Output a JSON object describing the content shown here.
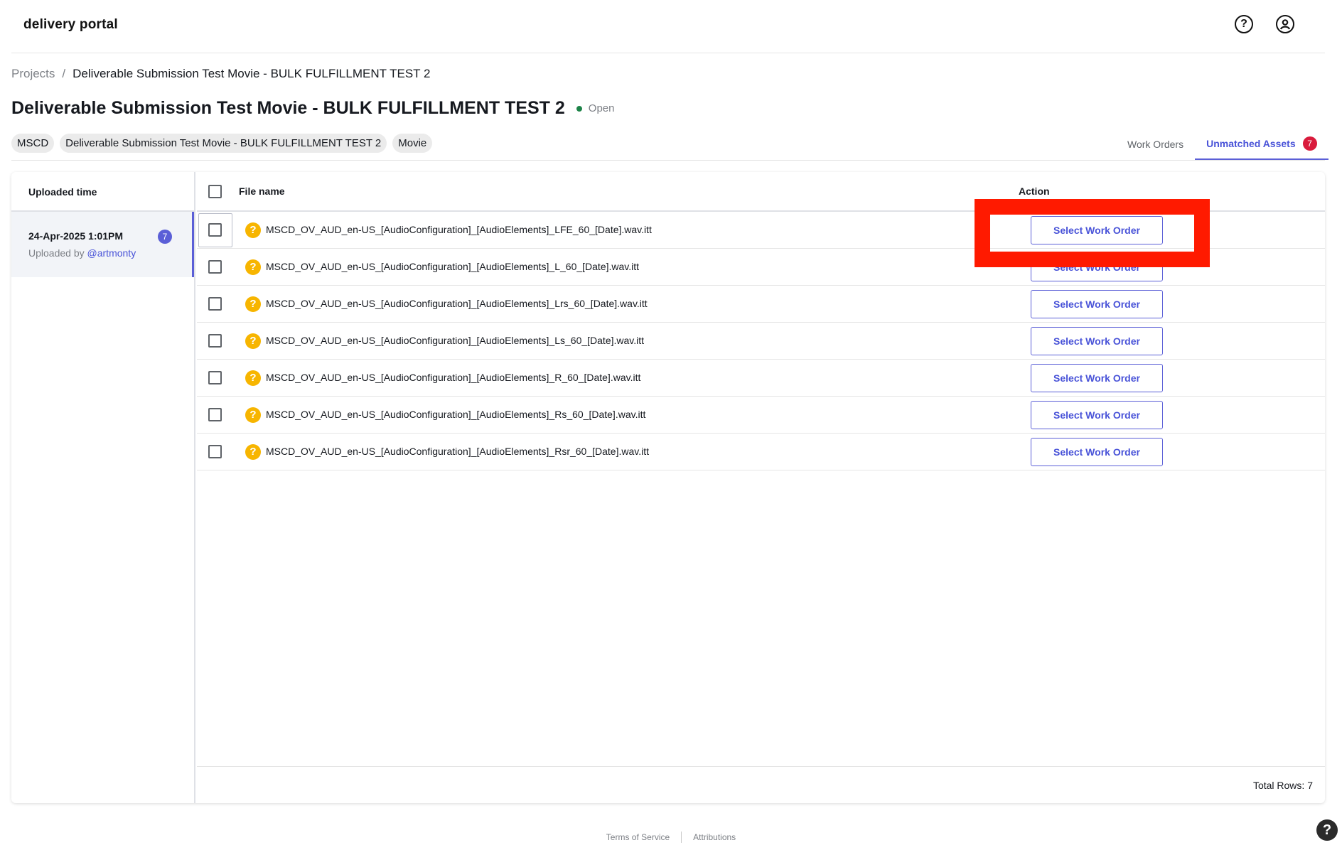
{
  "header": {
    "logo": "delivery portal",
    "help_icon": "help-circle-icon",
    "user_icon": "user-circle-icon"
  },
  "breadcrumb": {
    "root": "Projects",
    "separator": "/",
    "current": "Deliverable Submission Test Movie - BULK FULFILLMENT TEST 2"
  },
  "page": {
    "title": "Deliverable Submission Test Movie - BULK FULFILLMENT TEST 2",
    "status": "Open",
    "status_color": "#1d8348",
    "tags": [
      "MSCD",
      "Deliverable Submission Test Movie - BULK FULFILLMENT TEST 2",
      "Movie"
    ]
  },
  "tabs": [
    {
      "label": "Work Orders",
      "active": false
    },
    {
      "label": "Unmatched Assets",
      "active": true,
      "badge": "7"
    }
  ],
  "left_panel": {
    "header": "Uploaded time",
    "uploads": [
      {
        "time": "24-Apr-2025 1:01PM",
        "by_prefix": "Uploaded by",
        "user": "@artmonty",
        "count": "7"
      }
    ]
  },
  "table": {
    "columns": {
      "file": "File name",
      "action": "Action"
    },
    "action_label": "Select Work Order",
    "rows": [
      {
        "file": "MSCD_OV_AUD_en-US_[AudioConfiguration]_[AudioElements]_LFE_60_[Date].wav.itt"
      },
      {
        "file": "MSCD_OV_AUD_en-US_[AudioConfiguration]_[AudioElements]_L_60_[Date].wav.itt"
      },
      {
        "file": "MSCD_OV_AUD_en-US_[AudioConfiguration]_[AudioElements]_Lrs_60_[Date].wav.itt"
      },
      {
        "file": "MSCD_OV_AUD_en-US_[AudioConfiguration]_[AudioElements]_Ls_60_[Date].wav.itt"
      },
      {
        "file": "MSCD_OV_AUD_en-US_[AudioConfiguration]_[AudioElements]_R_60_[Date].wav.itt"
      },
      {
        "file": "MSCD_OV_AUD_en-US_[AudioConfiguration]_[AudioElements]_Rs_60_[Date].wav.itt"
      },
      {
        "file": "MSCD_OV_AUD_en-US_[AudioConfiguration]_[AudioElements]_Rsr_60_[Date].wav.itt"
      }
    ],
    "total_rows": "Total Rows: 7"
  },
  "footer": {
    "terms": "Terms of Service",
    "attributions": "Attributions",
    "help_fab": "?"
  },
  "colors": {
    "accent": "#5b5fd7",
    "badge_red": "#d91b3c",
    "warning": "#f7b500",
    "highlight": "#ff1a00"
  }
}
